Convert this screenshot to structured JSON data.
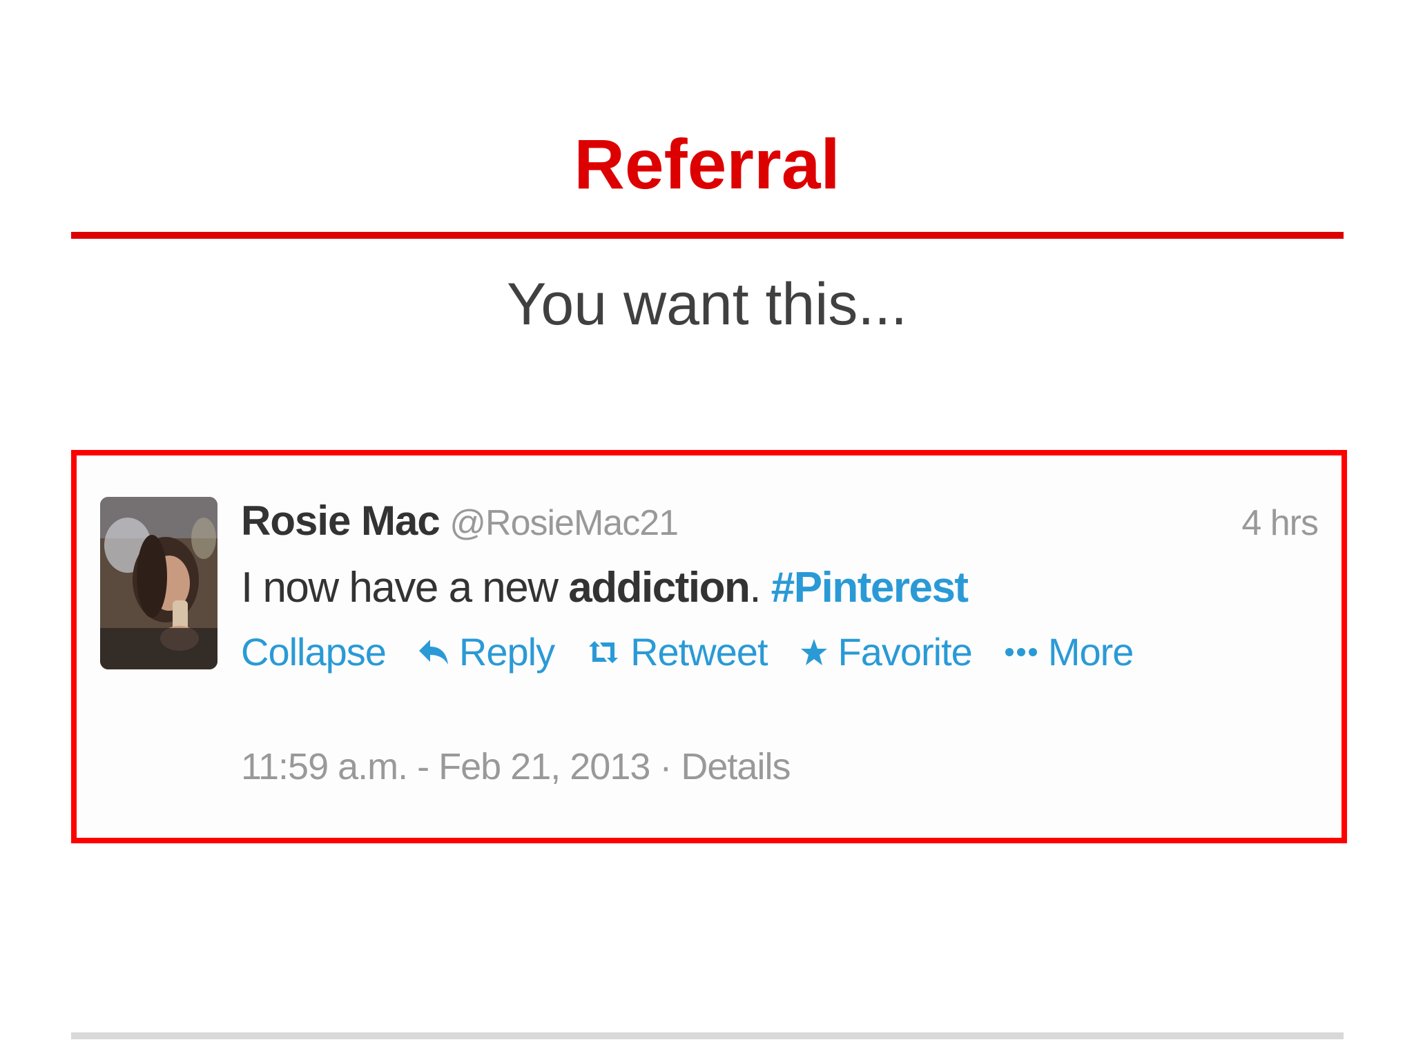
{
  "slide": {
    "title": "Referral",
    "subtitle": "You want this..."
  },
  "colors": {
    "accent": "#dd0000",
    "frame": "#ff0000",
    "link": "#2a9ad6",
    "muted": "#999999",
    "text": "#333333"
  },
  "tweet": {
    "author_name": "Rosie Mac",
    "author_handle": "@RosieMac21",
    "time_ago": "4 hrs",
    "text_plain": "I now have a new ",
    "text_strong": "addiction",
    "text_period": ". ",
    "hashtag": "#Pinterest",
    "actions": {
      "collapse": "Collapse",
      "reply": "Reply",
      "retweet": "Retweet",
      "favorite": "Favorite",
      "more": "More"
    },
    "timestamp": "11:59 a.m. - Feb 21, 2013",
    "separator": " · ",
    "details": "Details"
  },
  "icons": {
    "avatar": "profile-photo",
    "reply": "reply-arrow-icon",
    "retweet": "retweet-icon",
    "favorite": "star-icon",
    "more": "dots-icon"
  }
}
